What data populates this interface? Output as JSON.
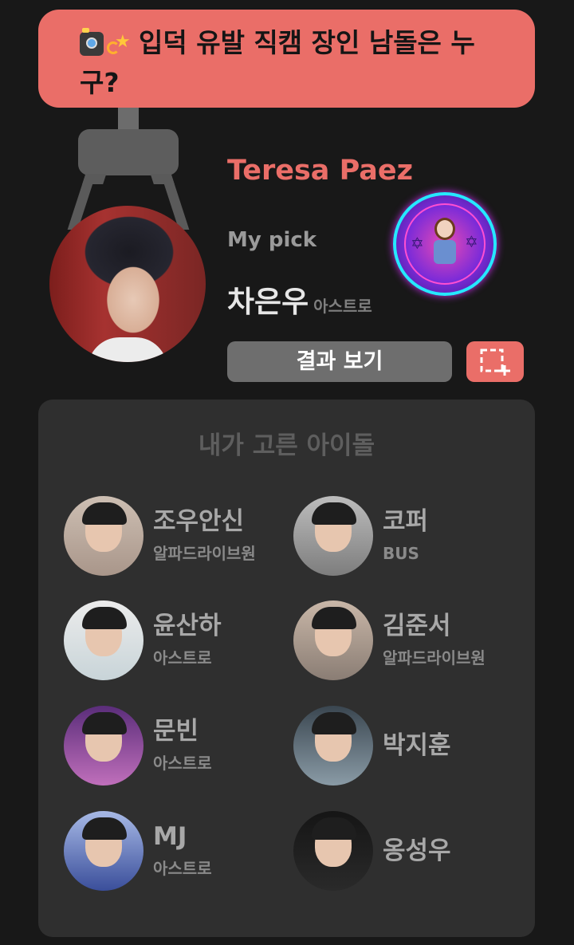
{
  "banner": {
    "icons": [
      "camera-flash-icon",
      "dizzy-icon"
    ],
    "title": "입덕 유발 직캠 장인 남돌은 누구?"
  },
  "profile": {
    "username": "Teresa Paez",
    "my_pick_label": "My pick",
    "pick_name": "차은우",
    "pick_agency": "아스트로",
    "result_button": "결과 보기",
    "capture_icon": "screenshot-capture-icon"
  },
  "colors": {
    "accent": "#ea6e68",
    "background": "#181818",
    "panel": "#2f2f2f"
  },
  "panel": {
    "title": "내가 고른 아이돌",
    "idols": [
      {
        "name": "조우안신",
        "agency": "알파드라이브원"
      },
      {
        "name": "코퍼",
        "agency": "BUS"
      },
      {
        "name": "윤산하",
        "agency": "아스트로"
      },
      {
        "name": "김준서",
        "agency": "알파드라이브원"
      },
      {
        "name": "문빈",
        "agency": "아스트로"
      },
      {
        "name": "박지훈",
        "agency": ""
      },
      {
        "name": "MJ",
        "agency": "아스트로"
      },
      {
        "name": "옹성우",
        "agency": ""
      }
    ]
  }
}
